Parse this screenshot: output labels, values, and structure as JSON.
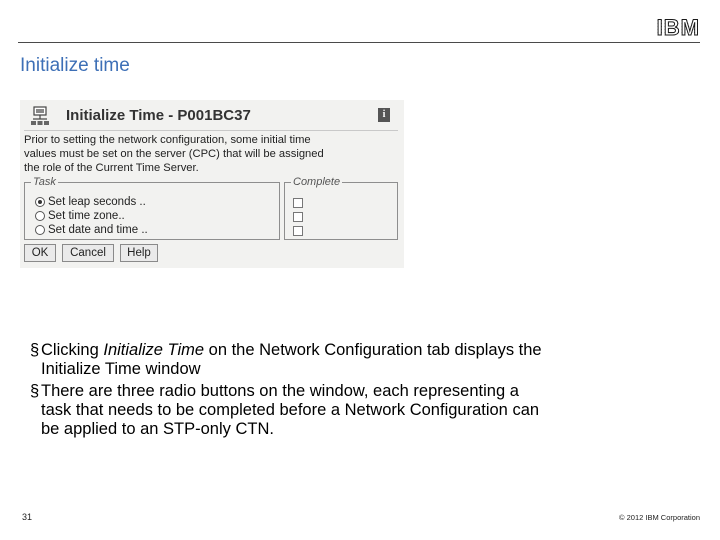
{
  "header": {
    "logo": "IBM",
    "title": "Initialize time"
  },
  "dialog": {
    "title": "Initialize Time - P001BC37",
    "info_label": "i",
    "intro_lines": [
      "Prior to setting the network configuration, some initial time",
      "values must be set on the server (CPC) that will be assigned",
      "the role of the Current Time Server."
    ],
    "task_legend": "Task",
    "complete_legend": "Complete",
    "tasks": [
      {
        "label": "Set leap seconds ..",
        "selected": true,
        "complete": false
      },
      {
        "label": "Set time zone..",
        "selected": false,
        "complete": false
      },
      {
        "label": "Set date and time ..",
        "selected": false,
        "complete": false
      }
    ],
    "buttons": {
      "ok": "OK",
      "cancel": "Cancel",
      "help": "Help"
    }
  },
  "bullets": [
    {
      "pre": "Clicking ",
      "emph": "Initialize Time",
      "post": " on the Network Configuration tab displays the",
      "line2": "Initialize Time window"
    },
    {
      "line1": "There are three radio buttons on the window, each representing a",
      "line2": "task that needs to be completed before a Network Configuration can",
      "line3": "be applied to an STP-only CTN."
    }
  ],
  "bullet_marker": "§",
  "footer": {
    "page_number": "31",
    "copyright": "© 2012 IBM Corporation"
  },
  "colors": {
    "title": "#3d6fb6",
    "rule": "#4a4a4a"
  }
}
